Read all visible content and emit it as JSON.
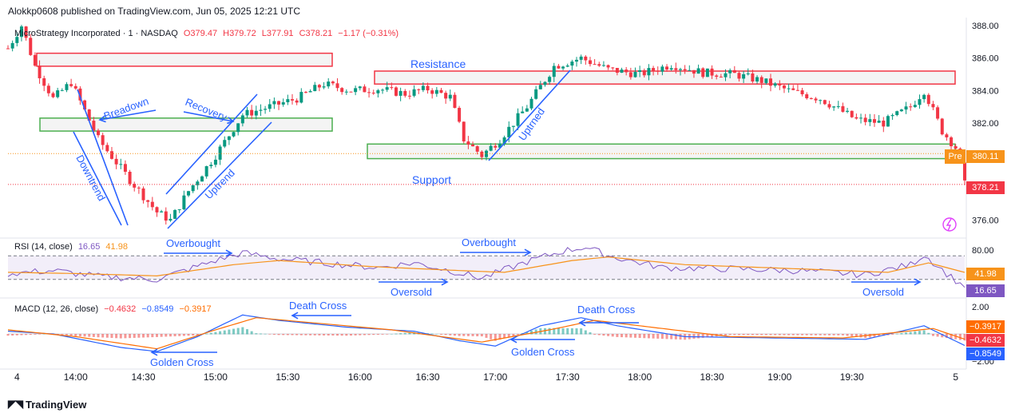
{
  "publish": {
    "text": "Alokkp0608 published on TradingView.com, Jun 05, 2025 12:21 UTC"
  },
  "main_legend": {
    "symbol": "MicroStrategy Incorporated · 1 · NASDAQ",
    "open": "O379.47",
    "high": "H379.72",
    "low": "L377.91",
    "close": "C378.21",
    "change": "−1.17 (−0.31%)"
  },
  "rsi_legend": {
    "name": "RSI (14, close)",
    "rsi_value": "16.65",
    "ma_value": "41.98"
  },
  "macd_legend": {
    "name": "MACD (12, 26, close)",
    "hist_value": "−0.4632",
    "macd_value": "−0.8549",
    "signal_value": "−0.3917"
  },
  "price_axis": {
    "ticks": [
      "388.00",
      "386.00",
      "384.00",
      "382.00",
      "376.00"
    ]
  },
  "rsi_axis": {
    "ticks": [
      "80.00"
    ],
    "labels": [
      "41.98",
      "16.65"
    ]
  },
  "macd_axis": {
    "ticks": [
      "2.00",
      "−2.00"
    ],
    "labels": [
      "−0.3917",
      "−0.4632",
      "−0.8549"
    ]
  },
  "price_tags": {
    "pre_label": "Pre",
    "pre_price": "380.11",
    "last_price": "378.21"
  },
  "time_axis": {
    "ticks": [
      "4",
      "14:00",
      "14:30",
      "15:00",
      "15:30",
      "16:00",
      "16:30",
      "17:00",
      "17:30",
      "18:00",
      "18:30",
      "19:00",
      "19:30",
      "5"
    ]
  },
  "annotations": {
    "breadown": "Breadown",
    "recovery": "Recovery",
    "downtrend": "Downtrend",
    "uptrend_left": "Uptrend",
    "uptrned": "Uptrned",
    "resistance": "Resistance",
    "support": "Support",
    "overbought_1": "Overbought",
    "overbought_2": "Overbought",
    "oversold_1": "Oversold",
    "oversold_2": "Oversold",
    "death_cross_1": "Death Cross",
    "death_cross_2": "Death Cross",
    "golden_cross_1": "Golden Cross",
    "golden_cross_2": "Golden Cross"
  },
  "footer": {
    "brand": "TradingView"
  },
  "colors": {
    "up": "#089981",
    "down": "#f23645",
    "annotation": "#2962ff",
    "resistance_box": "#f23645",
    "support_box": "#4caf50",
    "rsi_line": "#7e57c2",
    "rsi_ma": "#f7931a",
    "macd_line": "#2962ff",
    "signal_line": "#ff6d00"
  },
  "chart_data": {
    "type": "candlestick",
    "title": "MicroStrategy Incorporated · 1 · NASDAQ",
    "timeframe": "1",
    "y_range": [
      375.0,
      388.5
    ],
    "x_ticks": [
      "4",
      "14:00",
      "14:30",
      "15:00",
      "15:30",
      "16:00",
      "16:30",
      "17:00",
      "17:30",
      "18:00",
      "18:30",
      "19:00",
      "19:30",
      "5"
    ],
    "price_path": [
      [
        0,
        386.6
      ],
      [
        3,
        388.0
      ],
      [
        6,
        385.5
      ],
      [
        10,
        383.5
      ],
      [
        14,
        384.5
      ],
      [
        20,
        381.0
      ],
      [
        27,
        378.5
      ],
      [
        33,
        376.5
      ],
      [
        36,
        376.0
      ],
      [
        40,
        377.8
      ],
      [
        46,
        380.0
      ],
      [
        52,
        382.5
      ],
      [
        58,
        383.0
      ],
      [
        64,
        383.5
      ],
      [
        70,
        384.4
      ],
      [
        76,
        384.0
      ],
      [
        82,
        384.1
      ],
      [
        88,
        383.8
      ],
      [
        93,
        384.1
      ],
      [
        98,
        383.6
      ],
      [
        101,
        381.0
      ],
      [
        105,
        380.0
      ],
      [
        109,
        381.0
      ],
      [
        115,
        383.0
      ],
      [
        121,
        385.5
      ],
      [
        127,
        386.0
      ],
      [
        133,
        385.3
      ],
      [
        140,
        385.0
      ],
      [
        147,
        385.6
      ],
      [
        154,
        385.1
      ],
      [
        161,
        385.0
      ],
      [
        167,
        384.6
      ],
      [
        173,
        384.0
      ],
      [
        180,
        383.5
      ],
      [
        188,
        382.2
      ],
      [
        194,
        382.0
      ],
      [
        200,
        383.0
      ],
      [
        203,
        384.0
      ],
      [
        207,
        381.5
      ],
      [
        210,
        380.5
      ],
      [
        212,
        378.2
      ]
    ],
    "resistance_zones": [
      {
        "label": "",
        "low": 385.5,
        "high": 386.3
      },
      {
        "label": "Resistance",
        "low": 384.4,
        "high": 385.2
      }
    ],
    "support_zones": [
      {
        "label": "",
        "low": 381.5,
        "high": 382.3
      },
      {
        "label": "Support",
        "low": 379.8,
        "high": 380.7
      }
    ],
    "last_price": 378.21,
    "pre_price": 380.11,
    "rsi": {
      "period": 14,
      "value": 16.65,
      "ma": 41.98,
      "upper_band": 70,
      "lower_band": 30,
      "path": [
        [
          0,
          40
        ],
        [
          10,
          45
        ],
        [
          20,
          35
        ],
        [
          33,
          30
        ],
        [
          46,
          62
        ],
        [
          52,
          75
        ],
        [
          60,
          65
        ],
        [
          70,
          58
        ],
        [
          82,
          50
        ],
        [
          90,
          58
        ],
        [
          98,
          45
        ],
        [
          105,
          32
        ],
        [
          115,
          60
        ],
        [
          123,
          78
        ],
        [
          128,
          85
        ],
        [
          133,
          70
        ],
        [
          145,
          50
        ],
        [
          160,
          48
        ],
        [
          175,
          45
        ],
        [
          190,
          38
        ],
        [
          200,
          55
        ],
        [
          203,
          72
        ],
        [
          208,
          40
        ],
        [
          212,
          16.65
        ]
      ],
      "ma_path": [
        [
          0,
          42
        ],
        [
          15,
          40
        ],
        [
          33,
          36
        ],
        [
          50,
          55
        ],
        [
          60,
          62
        ],
        [
          80,
          52
        ],
        [
          100,
          45
        ],
        [
          110,
          42
        ],
        [
          125,
          62
        ],
        [
          133,
          68
        ],
        [
          150,
          55
        ],
        [
          175,
          48
        ],
        [
          195,
          42
        ],
        [
          204,
          58
        ],
        [
          212,
          41.98
        ]
      ]
    },
    "macd": {
      "fast": 12,
      "slow": 26,
      "macd": -0.8549,
      "signal": -0.3917,
      "histogram": -0.4632,
      "macd_path": [
        [
          0,
          0.2
        ],
        [
          10,
          0.0
        ],
        [
          25,
          -1.0
        ],
        [
          33,
          -1.3
        ],
        [
          42,
          -0.2
        ],
        [
          52,
          1.4
        ],
        [
          60,
          1.0
        ],
        [
          75,
          0.5
        ],
        [
          90,
          0.2
        ],
        [
          100,
          -0.5
        ],
        [
          108,
          -0.9
        ],
        [
          118,
          0.6
        ],
        [
          127,
          1.2
        ],
        [
          135,
          0.6
        ],
        [
          150,
          -0.2
        ],
        [
          170,
          -0.3
        ],
        [
          190,
          -0.4
        ],
        [
          203,
          0.6
        ],
        [
          212,
          -0.8549
        ]
      ],
      "signal_path": [
        [
          0,
          0.3
        ],
        [
          15,
          -0.2
        ],
        [
          33,
          -1.1
        ],
        [
          45,
          0.2
        ],
        [
          55,
          1.2
        ],
        [
          65,
          0.9
        ],
        [
          85,
          0.3
        ],
        [
          105,
          -0.6
        ],
        [
          120,
          0.3
        ],
        [
          130,
          1.0
        ],
        [
          140,
          0.6
        ],
        [
          160,
          -0.2
        ],
        [
          185,
          -0.3
        ],
        [
          205,
          0.4
        ],
        [
          212,
          -0.3917
        ]
      ]
    }
  }
}
